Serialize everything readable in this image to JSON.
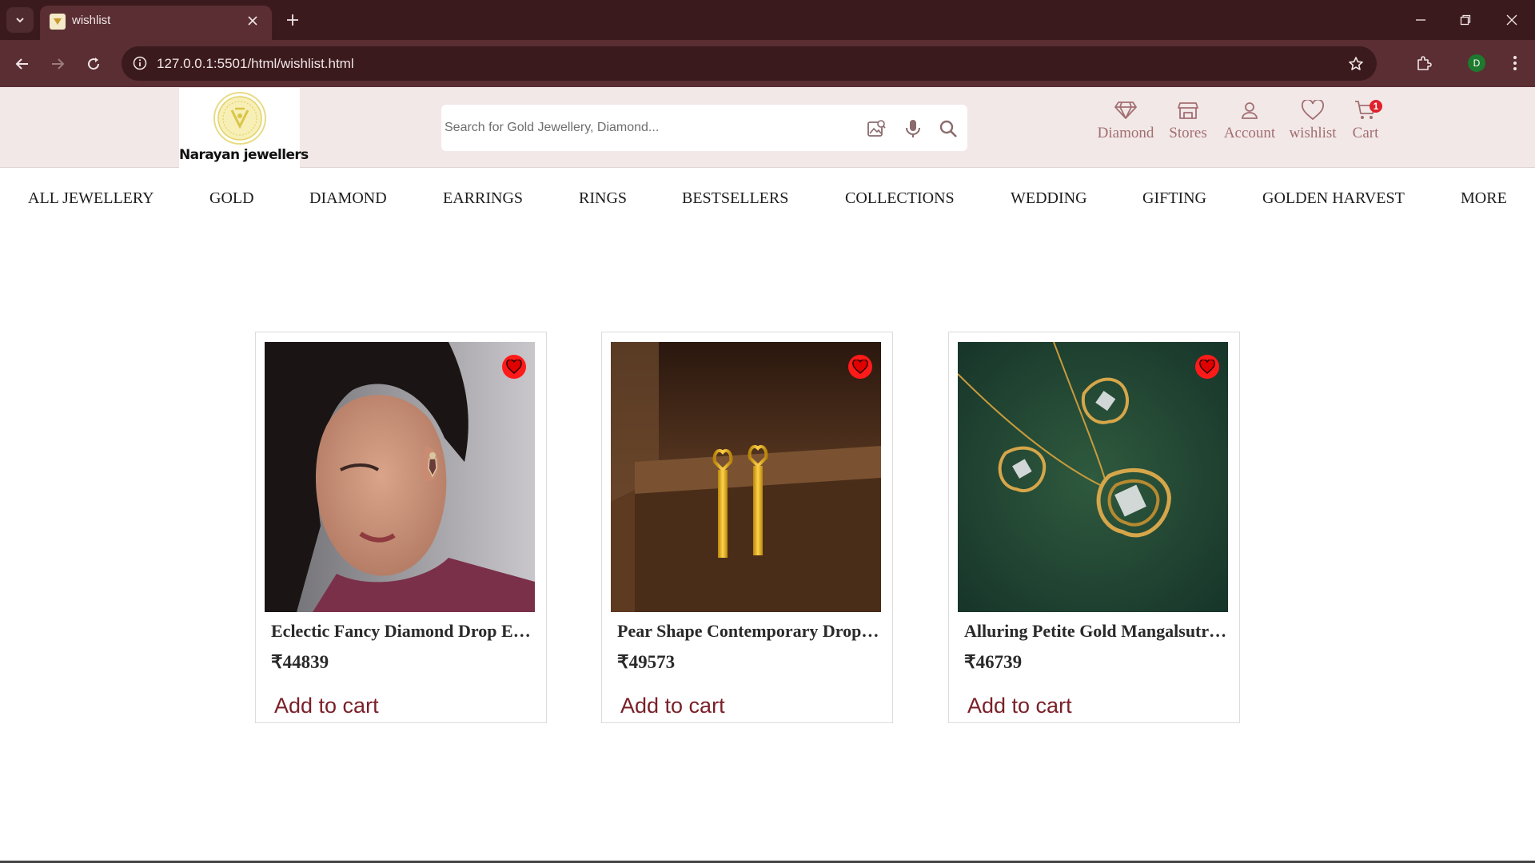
{
  "browser": {
    "tab_title": "wishlist",
    "url": "127.0.0.1:5501/html/wishlist.html",
    "profile_initial": "D"
  },
  "site": {
    "brand_name": "Narayan jewellers",
    "search": {
      "placeholder": "Search for Gold Jewellery, Diamond..."
    },
    "header_links": [
      {
        "label": "Diamond",
        "icon": "diamond-icon"
      },
      {
        "label": "Stores",
        "icon": "store-icon"
      },
      {
        "label": "Account",
        "icon": "account-icon"
      },
      {
        "label": "wishlist",
        "icon": "heart-icon"
      },
      {
        "label": "Cart",
        "icon": "cart-icon"
      }
    ],
    "cart_count": "1"
  },
  "categories": [
    "ALL JEWELLERY",
    "GOLD",
    "DIAMOND",
    "EARRINGS",
    "RINGS",
    "BESTSELLERS",
    "COLLECTIONS",
    "WEDDING",
    "GIFTING",
    "GOLDEN HARVEST",
    "MORE"
  ],
  "wishlist": [
    {
      "title": "Eclectic Fancy Diamond Drop Earrings",
      "price": "₹44839",
      "cta": "Add to cart"
    },
    {
      "title": "Pear Shape Contemporary Drop Earrings",
      "price": "₹49573",
      "cta": "Add to cart"
    },
    {
      "title": "Alluring Petite Gold Mangalsutra Set",
      "price": "₹46739",
      "cta": "Add to cart"
    }
  ],
  "colors": {
    "chrome_dark": "#3b1a1d",
    "chrome_mid": "#5a2e33",
    "header_bg": "#f2e8e7",
    "icon_muted": "#a26f72",
    "accent_red": "#ff1a1a",
    "cta_color": "#7a1f28"
  }
}
